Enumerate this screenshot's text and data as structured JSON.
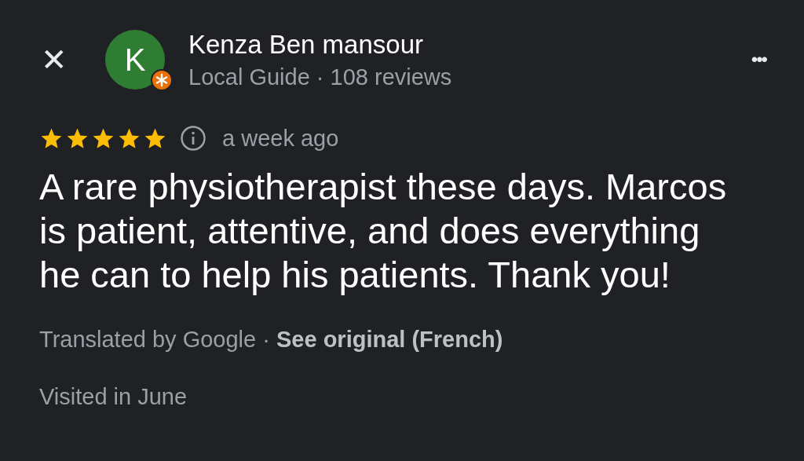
{
  "header": {
    "close": "✕",
    "avatar_letter": "K",
    "name": "Kenza Ben mansour",
    "subtitle": "Local Guide · 108 reviews",
    "more": "•••"
  },
  "review": {
    "stars": 5,
    "time": "a week ago",
    "text": "A rare physiotherapist these days. Marcos is patient, attentive, and does everything he can to help his patients. Thank you!"
  },
  "translation": {
    "note": "Translated by Google · ",
    "link": "See original (French)"
  },
  "visited": "Visited in June"
}
